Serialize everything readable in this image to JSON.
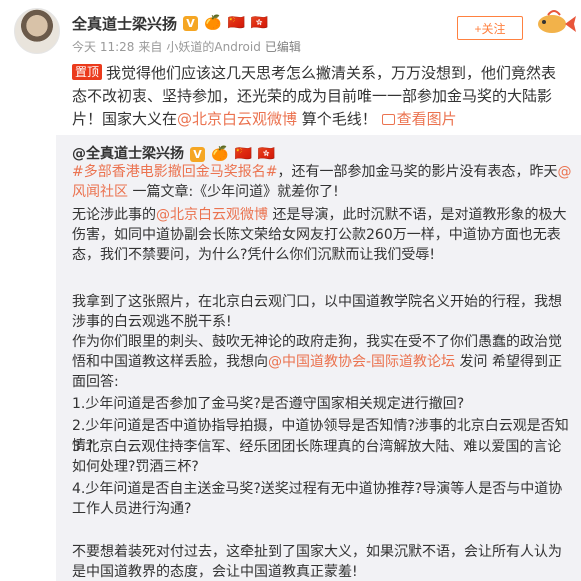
{
  "author": {
    "name": "全真道士梁兴扬",
    "v_badge": "V",
    "badges": [
      "🍊",
      "🇨🇳",
      "🇭🇰"
    ]
  },
  "meta": {
    "time": "今天 11:28",
    "source_prefix": "来自",
    "source": "小妖道的Android",
    "edited": "已编辑"
  },
  "follow": {
    "label": "+关注"
  },
  "post": {
    "pin": "置顶",
    "text_a": "我觉得他们应该这几天思考怎么撇清关系，万万没想到，他们竟然表态不改初衷、坚持参加，还光荣的成为目前唯一一部参加金马奖的大陆影片！国家大义在",
    "link": "@北京白云观微博",
    "text_b": " 算个毛线！",
    "view_image": "查看图片"
  },
  "repost": {
    "author": "@全真道士梁兴扬",
    "v_badge": "V",
    "badges": [
      "🍊",
      "🇨🇳",
      "🇭🇰"
    ],
    "p1": {
      "tag": "#多部香港电影撤回金马奖报名#",
      "t1": "，还有一部参加金马奖的影片没有表态，昨天",
      "link1": "@风闻社区",
      "t2": " 一篇文章:《少年问道》就差你了!"
    },
    "p2": {
      "t1": "无论涉此事的",
      "link1": "@北京白云观微博",
      "t2": " 还是导演，此时沉默不语，是对道教形象的极大伤害，如同中道协副会长陈文荣给女网友打公款260万一样，中道协方面也无表态，我们不禁要问，为什么?凭什么你们沉默而让我们受辱!"
    },
    "p3": "我拿到了这张照片，在北京白云观门口，以中国道教学院名义开始的行程，我想涉事的白云观逃不脱干系!",
    "p4": {
      "t1": "作为你们眼里的刺头、鼓吹无神论的政府走狗，我实在受不了你们愚蠢的政治觉悟和中国道教这样丢脸，我想向",
      "link1": "@中国道教协会-国际道教论坛",
      "t2": " 发问 希望得到正面回答:"
    },
    "q1": "1.少年问道是否参加了金马奖?是否遵守国家相关规定进行撤回?",
    "q2": "2.少年问道是否中道协指导拍摄，中道协领导是否知情?涉事的北京白云观是否知情?",
    "q3": "3.北京白云观住持李信军、经乐团团长陈理真的台湾解放大陆、难以爱国的言论如何处理?罚酒三杯?",
    "q4": "4.少年问道是否自主送金马奖?送奖过程有无中道协推荐?导演等人是否与中道协工作人员进行沟通?",
    "p5": "不要想着装死对付过去，这牵扯到了国家大义，如果沉默不语，会让所有人认为是中国道教界的态度，会让中国道教真正蒙羞!"
  },
  "colors": {
    "link": "#eb7350",
    "pin": "#eb3a1c",
    "follow": "#ff8140",
    "repost_bg": "#f2f2f5"
  }
}
